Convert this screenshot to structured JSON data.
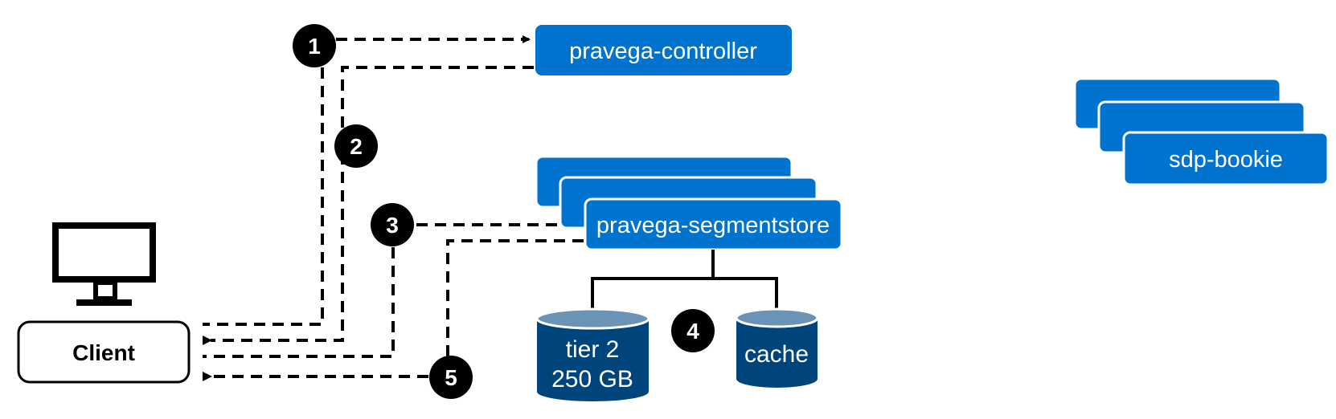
{
  "colors": {
    "node_blue": "#0073CF",
    "db_body": "#00447C",
    "db_top": "#6A93B5",
    "step_fill": "#000000",
    "line": "#000000"
  },
  "nodes": {
    "controller": {
      "label": "pravega-controller"
    },
    "segmentstore": {
      "label": "pravega-segmentstore",
      "replicas": 3
    },
    "bookie": {
      "label": "sdp-bookie",
      "replicas": 3
    },
    "client": {
      "label": "Client",
      "icon": "monitor-icon"
    }
  },
  "storage": {
    "tier2": {
      "line1": "tier 2",
      "line2": "250 GB"
    },
    "cache": {
      "label": "cache"
    }
  },
  "steps": [
    {
      "label": "1"
    },
    {
      "label": "2"
    },
    {
      "label": "3"
    },
    {
      "label": "4"
    },
    {
      "label": "5"
    }
  ]
}
